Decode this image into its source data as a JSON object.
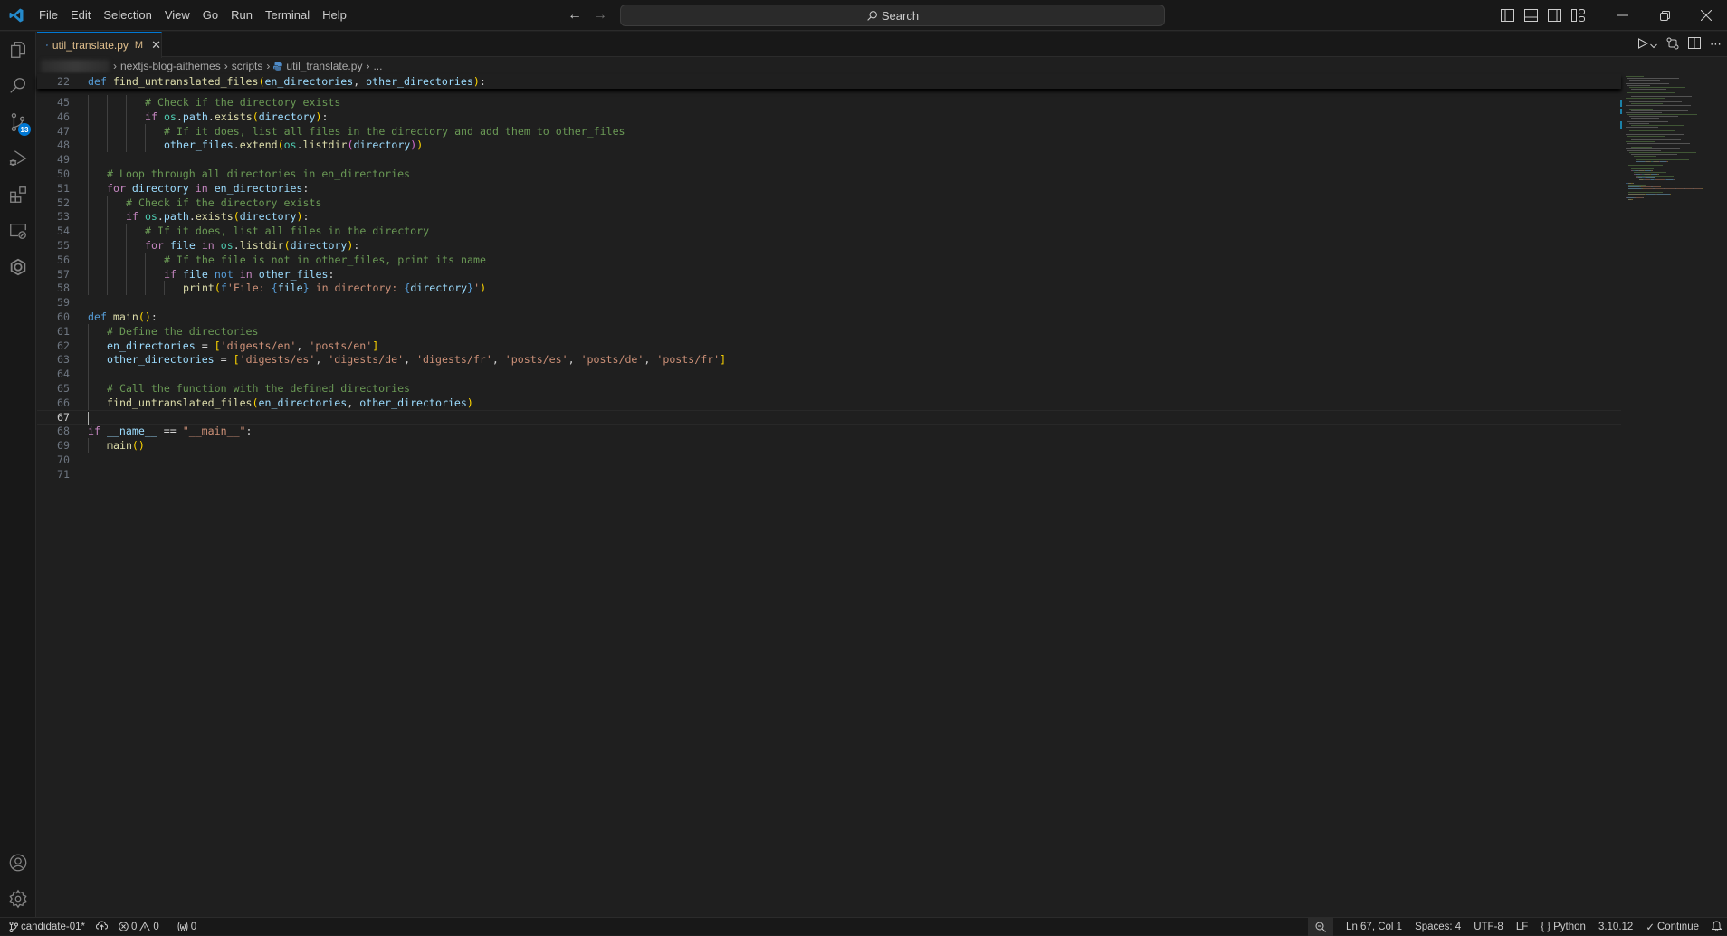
{
  "menu": [
    "File",
    "Edit",
    "Selection",
    "View",
    "Go",
    "Run",
    "Terminal",
    "Help"
  ],
  "search": {
    "placeholder": "Search"
  },
  "activity": {
    "source_control_badge": "13"
  },
  "tab": {
    "filename": "util_translate.py",
    "status": "M"
  },
  "breadcrumb": {
    "items": [
      "nextjs-blog-aithemes",
      "scripts",
      "util_translate.py",
      "..."
    ]
  },
  "editor": {
    "sticky": {
      "number": "22",
      "parts": [
        [
          "k",
          "def "
        ],
        [
          "fn",
          "find_untranslated_files"
        ],
        [
          "b1",
          "("
        ],
        [
          "v",
          "en_directories"
        ],
        [
          "op",
          ", "
        ],
        [
          "v",
          "other_directories"
        ],
        [
          "b1",
          ")"
        ],
        [
          "op",
          ":"
        ]
      ]
    },
    "lines": [
      {
        "number": "45",
        "indent": 3,
        "parts": [
          [
            "c",
            "# Check if the directory exists"
          ]
        ]
      },
      {
        "number": "46",
        "indent": 3,
        "parts": [
          [
            "kc",
            "if "
          ],
          [
            "cls",
            "os"
          ],
          [
            "op",
            "."
          ],
          [
            "v",
            "path"
          ],
          [
            "op",
            "."
          ],
          [
            "fn",
            "exists"
          ],
          [
            "b1",
            "("
          ],
          [
            "v",
            "directory"
          ],
          [
            "b1",
            ")"
          ],
          [
            "op",
            ":"
          ]
        ]
      },
      {
        "number": "47",
        "indent": 4,
        "parts": [
          [
            "c",
            "# If it does, list all files in the directory and add them to other_files"
          ]
        ]
      },
      {
        "number": "48",
        "indent": 4,
        "parts": [
          [
            "v",
            "other_files"
          ],
          [
            "op",
            "."
          ],
          [
            "fn",
            "extend"
          ],
          [
            "b1",
            "("
          ],
          [
            "cls",
            "os"
          ],
          [
            "op",
            "."
          ],
          [
            "fn",
            "listdir"
          ],
          [
            "b2",
            "("
          ],
          [
            "v",
            "directory"
          ],
          [
            "b2",
            ")"
          ],
          [
            "b1",
            ")"
          ]
        ]
      },
      {
        "number": "49",
        "indent": 0,
        "parts": []
      },
      {
        "number": "50",
        "indent": 1,
        "parts": [
          [
            "c",
            "# Loop through all directories in en_directories"
          ]
        ]
      },
      {
        "number": "51",
        "indent": 1,
        "parts": [
          [
            "kc",
            "for "
          ],
          [
            "v",
            "directory "
          ],
          [
            "kc",
            "in "
          ],
          [
            "v",
            "en_directories"
          ],
          [
            "op",
            ":"
          ]
        ]
      },
      {
        "number": "52",
        "indent": 2,
        "parts": [
          [
            "c",
            "# Check if the directory exists"
          ]
        ]
      },
      {
        "number": "53",
        "indent": 2,
        "parts": [
          [
            "kc",
            "if "
          ],
          [
            "cls",
            "os"
          ],
          [
            "op",
            "."
          ],
          [
            "v",
            "path"
          ],
          [
            "op",
            "."
          ],
          [
            "fn",
            "exists"
          ],
          [
            "b1",
            "("
          ],
          [
            "v",
            "directory"
          ],
          [
            "b1",
            ")"
          ],
          [
            "op",
            ":"
          ]
        ]
      },
      {
        "number": "54",
        "indent": 3,
        "parts": [
          [
            "c",
            "# If it does, list all files in the directory"
          ]
        ]
      },
      {
        "number": "55",
        "indent": 3,
        "parts": [
          [
            "kc",
            "for "
          ],
          [
            "v",
            "file "
          ],
          [
            "kc",
            "in "
          ],
          [
            "cls",
            "os"
          ],
          [
            "op",
            "."
          ],
          [
            "fn",
            "listdir"
          ],
          [
            "b1",
            "("
          ],
          [
            "v",
            "directory"
          ],
          [
            "b1",
            ")"
          ],
          [
            "op",
            ":"
          ]
        ]
      },
      {
        "number": "56",
        "indent": 4,
        "parts": [
          [
            "c",
            "# If the file is not in other_files, print its name"
          ]
        ]
      },
      {
        "number": "57",
        "indent": 4,
        "parts": [
          [
            "kc",
            "if "
          ],
          [
            "v",
            "file "
          ],
          [
            "k",
            "not "
          ],
          [
            "kc",
            "in "
          ],
          [
            "v",
            "other_files"
          ],
          [
            "op",
            ":"
          ]
        ]
      },
      {
        "number": "58",
        "indent": 5,
        "parts": [
          [
            "fn",
            "print"
          ],
          [
            "b1",
            "("
          ],
          [
            "k",
            "f"
          ],
          [
            "s",
            "'File: "
          ],
          [
            "k",
            "{"
          ],
          [
            "v",
            "file"
          ],
          [
            "k",
            "}"
          ],
          [
            "s",
            " in directory: "
          ],
          [
            "k",
            "{"
          ],
          [
            "v",
            "directory"
          ],
          [
            "k",
            "}"
          ],
          [
            "s",
            "'"
          ],
          [
            "b1",
            ")"
          ]
        ]
      },
      {
        "number": "59",
        "indent": 0,
        "parts": []
      },
      {
        "number": "60",
        "indent": 0,
        "parts": [
          [
            "k",
            "def "
          ],
          [
            "fn",
            "main"
          ],
          [
            "b1",
            "()"
          ],
          [
            "op",
            ":"
          ]
        ]
      },
      {
        "number": "61",
        "indent": 1,
        "parts": [
          [
            "c",
            "# Define the directories"
          ]
        ]
      },
      {
        "number": "62",
        "indent": 1,
        "parts": [
          [
            "v",
            "en_directories "
          ],
          [
            "op",
            "= "
          ],
          [
            "b1",
            "["
          ],
          [
            "s",
            "'digests/en'"
          ],
          [
            "op",
            ", "
          ],
          [
            "s",
            "'posts/en'"
          ],
          [
            "b1",
            "]"
          ]
        ]
      },
      {
        "number": "63",
        "indent": 1,
        "parts": [
          [
            "v",
            "other_directories "
          ],
          [
            "op",
            "= "
          ],
          [
            "b1",
            "["
          ],
          [
            "s",
            "'digests/es'"
          ],
          [
            "op",
            ", "
          ],
          [
            "s",
            "'digests/de'"
          ],
          [
            "op",
            ", "
          ],
          [
            "s",
            "'digests/fr'"
          ],
          [
            "op",
            ", "
          ],
          [
            "s",
            "'posts/es'"
          ],
          [
            "op",
            ", "
          ],
          [
            "s",
            "'posts/de'"
          ],
          [
            "op",
            ", "
          ],
          [
            "s",
            "'posts/fr'"
          ],
          [
            "b1",
            "]"
          ]
        ]
      },
      {
        "number": "64",
        "indent": 0,
        "parts": []
      },
      {
        "number": "65",
        "indent": 1,
        "parts": [
          [
            "c",
            "# Call the function with the defined directories"
          ]
        ]
      },
      {
        "number": "66",
        "indent": 1,
        "parts": [
          [
            "fn",
            "find_untranslated_files"
          ],
          [
            "b1",
            "("
          ],
          [
            "v",
            "en_directories"
          ],
          [
            "op",
            ", "
          ],
          [
            "v",
            "other_directories"
          ],
          [
            "b1",
            ")"
          ]
        ]
      },
      {
        "number": "67",
        "indent": 0,
        "parts": [],
        "active": true
      },
      {
        "number": "68",
        "indent": 0,
        "parts": [
          [
            "kc",
            "if "
          ],
          [
            "v",
            "__name__ "
          ],
          [
            "op",
            "== "
          ],
          [
            "s",
            "\"__main__\""
          ],
          [
            "op",
            ":"
          ]
        ]
      },
      {
        "number": "69",
        "indent": 1,
        "parts": [
          [
            "fn",
            "main"
          ],
          [
            "b1",
            "()"
          ]
        ]
      },
      {
        "number": "70",
        "indent": 0,
        "parts": []
      },
      {
        "number": "71",
        "indent": 0,
        "parts": []
      }
    ]
  },
  "status": {
    "branch": "candidate-01*",
    "errors": "0",
    "warnings": "0",
    "ports": "0",
    "position": "Ln 67, Col 1",
    "spaces": "Spaces: 4",
    "encoding": "UTF-8",
    "eol": "LF",
    "language": "Python",
    "interpreter": "3.10.12",
    "continue": "Continue"
  }
}
